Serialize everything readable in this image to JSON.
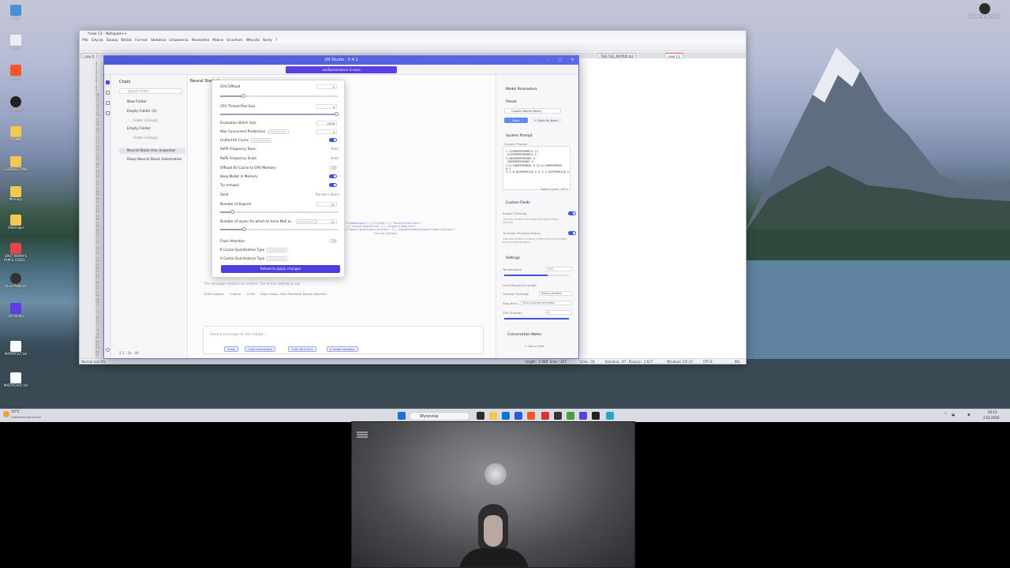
{
  "colors": {
    "accent": "#4b3fe0",
    "toggle_on": "#3a56e0",
    "titlebar": "#5a67e6"
  },
  "desktop": {
    "icons": [
      {
        "label": "Kosz",
        "icon": "recycle-bin-icon",
        "color": "#4a90d9"
      },
      {
        "label": "myfile",
        "icon": "file-icon",
        "color": "#eeeeee"
      },
      {
        "label": "Brave",
        "icon": "brave-icon",
        "color": "#fb542b"
      },
      {
        "label": "ChatGPT",
        "icon": "chatgpt-icon",
        "color": "#222222"
      },
      {
        "label": "CODING",
        "icon": "folder-icon",
        "color": "#f2c94c"
      },
      {
        "label": "CODEHOSTPAD",
        "icon": "folder-icon",
        "color": "#f2c94c"
      },
      {
        "label": "Memory",
        "icon": "folder-icon",
        "color": "#f2c94c"
      },
      {
        "label": "Ollamager",
        "icon": "folder-icon",
        "color": "#f2c94c"
      },
      {
        "label": "SPLIT MAMA'S FAM & GOOD...",
        "icon": "app-icon",
        "color": "#e84545"
      },
      {
        "label": "Rium Podcam",
        "icon": "webcam-app-icon",
        "color": "#333333"
      },
      {
        "label": "LM Studio",
        "icon": "lm-studio-icon",
        "color": "#5b3fe0"
      },
      {
        "label": "MATRYCA7.txt",
        "icon": "text-file-icon",
        "color": "#ffffff"
      },
      {
        "label": "MATRYCA07.txt",
        "icon": "text-file-icon",
        "color": "#ffffff"
      }
    ],
    "top_right_icon": {
      "label": "Szkolenia Wirtualne",
      "icon": "circle-app-icon"
    }
  },
  "taskbar": {
    "weather": "10°C",
    "weather_sub": "Częściowo słonecznie",
    "search_placeholder": "Wyszukaj",
    "time": "20:13",
    "date": "2.02.2026"
  },
  "notepad": {
    "title": "*new 13 - Notepad++",
    "menu": [
      "Plik",
      "Edycja",
      "Szukaj",
      "Widok",
      "Format",
      "Składnia",
      "Ustawienia",
      "Narzędzia",
      "Makra",
      "Uruchom",
      "Wtyczki",
      "Karty",
      "?"
    ],
    "tabs": [
      "new 9",
      "THE FILE_MATRIX.txt",
      "new 13"
    ],
    "gutter_lines": [
      "1",
      "2",
      "3",
      "4",
      "5",
      "6",
      "7",
      "8",
      "9",
      "10",
      "11",
      "12",
      "13",
      "14",
      "15",
      "16",
      "17",
      "18",
      "19",
      "20",
      "21",
      "22",
      "23",
      "24",
      "25",
      "26",
      "27",
      "28",
      "29",
      "30",
      "31",
      "32",
      "33",
      "34",
      "35",
      "36",
      "37",
      "38",
      "39",
      "40",
      "41",
      "42",
      "43",
      "44",
      "45",
      "46",
      "47",
      "48",
      "49",
      "50",
      "51",
      "52",
      "53",
      "54",
      "55",
      "56",
      "57",
      "58",
      "59",
      "60",
      "61",
      "62",
      "63",
      "64",
      "65",
      "66",
      "67",
      "68",
      "69",
      "70",
      "71",
      "72",
      "73",
      "74",
      "75",
      "76",
      "77",
      "78",
      "79",
      "80",
      "81",
      "82",
      "83",
      "84",
      "85",
      "86"
    ],
    "status": {
      "type": "Normal text file",
      "length": "length : 2 948",
      "lines": "lines : 207",
      "ln": "Linia : 34",
      "col": "Kolumna : 47",
      "pos": "Pozycja : 1 627",
      "eol": "Windows (CR LF)",
      "enc": "UTF-8",
      "mode": "INS"
    }
  },
  "lm": {
    "title": "LM Studio - 0.4.1",
    "model": "nvidia/nemotron-3-nano",
    "chats": {
      "header": "Chats",
      "search": "Search chats...",
      "items": [
        {
          "label": "New Folder",
          "type": "folder"
        },
        {
          "label": "Empty Folder (2)",
          "type": "folder"
        },
        {
          "label": "Folder is Empty",
          "type": "sub"
        },
        {
          "label": "Empty Folder",
          "type": "folder"
        },
        {
          "label": "Folder is Empty",
          "type": "sub"
        },
        {
          "label": "Neural Stack Hex Inspector",
          "type": "selected"
        },
        {
          "label": "Deep Neural Stack Automation",
          "type": "chat"
        }
      ],
      "bottom": "2.3 - 34 - 48"
    },
    "chat": {
      "title": "Neural Stack H",
      "code": "\"FileNamespace\":[\"FilePort\":[\"SocketInterface\":\n\"\":[\"channelIndexInts\":[],\"SignalIndexInts\"\n\":[\"openSignalSubscriptions\":[],\"openWriteableSignalSubscriptions\"\n                  :serializeSnes",
      "note": "This message contains no content. The AI has nothing to say.",
      "stats": [
        "79.69 tok/sec",
        "1 token",
        "0.53s",
        "Stop reason: Max Predicted Tokens Reached"
      ],
      "placeholder": "Send a message to the model...",
      "chips": [
        "Think",
        "Code Interpreter",
        "Chat with Files",
        "e-mode sandbox"
      ]
    },
    "params": {
      "rows": [
        {
          "label": "GPU Offload",
          "value": "0",
          "kind": "number"
        },
        {
          "label": "CPU Thread Pool Size",
          "value": "4",
          "kind": "number"
        },
        {
          "label": "Evaluation Batch Size",
          "value": "2048",
          "kind": "number"
        },
        {
          "label": "Max Concurrent Predictions",
          "value": "4",
          "kind": "number",
          "tag": "Experimental"
        },
        {
          "label": "Unified KV Cache",
          "kind": "toggle",
          "on": true,
          "tag": "Experimental"
        },
        {
          "label": "RoPE Frequency Base",
          "value": "Auto",
          "kind": "text"
        },
        {
          "label": "RoPE Frequency Scale",
          "value": "Auto",
          "kind": "text"
        },
        {
          "label": "Offload KV Cache to GPU Memory",
          "kind": "toggle",
          "on": false
        },
        {
          "label": "Keep Model in Memory",
          "kind": "toggle",
          "on": true
        },
        {
          "label": "Try mmap()",
          "kind": "toggle",
          "on": true
        },
        {
          "label": "Seed",
          "value": "Random Seed",
          "kind": "text"
        },
        {
          "label": "Number of Experts",
          "value": "10",
          "kind": "number"
        },
        {
          "label": "Number of layers for which to force MoE w...",
          "value": "10",
          "kind": "number",
          "tag": "Experimental"
        },
        {
          "label": "Flash Attention",
          "kind": "toggle",
          "on": false
        },
        {
          "label": "K Cache Quantization Type",
          "kind": "none",
          "tag": "Experimental"
        },
        {
          "label": "V Cache Quantization Type",
          "kind": "none",
          "tag": "Experimental"
        }
      ],
      "reload": "Reload to apply changes"
    },
    "right": {
      "title": "Model Parameters",
      "preset_label": "Preset",
      "preset_value": "Cosmic Neural Matrix",
      "save": "Save",
      "save_as": "+ Save As New...",
      "system_prompt_section": "System Prompt",
      "system_prompt_label": "System Prompt",
      "system_prompt_text": "1.47699999999674 11\n.476999999999674 1\n3.0839999999383 3\n.3839999999383 3\n2.0.54699999645 0.27.0.5469999645\n0.2\n3.2.0.0239999128 2.5 3.2.0239999128 2.5",
      "token_count": "Token count: 1874",
      "custom_fields": "Custom Fields",
      "enable_thinking": "Enable Thinking",
      "enable_thinking_desc": "Controls whether the model will think before replying",
      "truncate": "Truncate Thinking History",
      "truncate_desc": "Controls whether thinking history will be truncated to save context space",
      "settings": "Settings",
      "temperature": "Temperature",
      "temperature_value": "0.67",
      "limit": "Limit Response Length",
      "context_overflow": "Context Overflow",
      "context_overflow_value": "Rolling Window",
      "stop_strings": "Stop Strin...",
      "stop_placeholder": "Enter a string and press",
      "cpu_threads": "CPU Threads",
      "cpu_threads_value": "4",
      "notes": "Conversation Notes",
      "add_note": "+ Add a note"
    }
  }
}
